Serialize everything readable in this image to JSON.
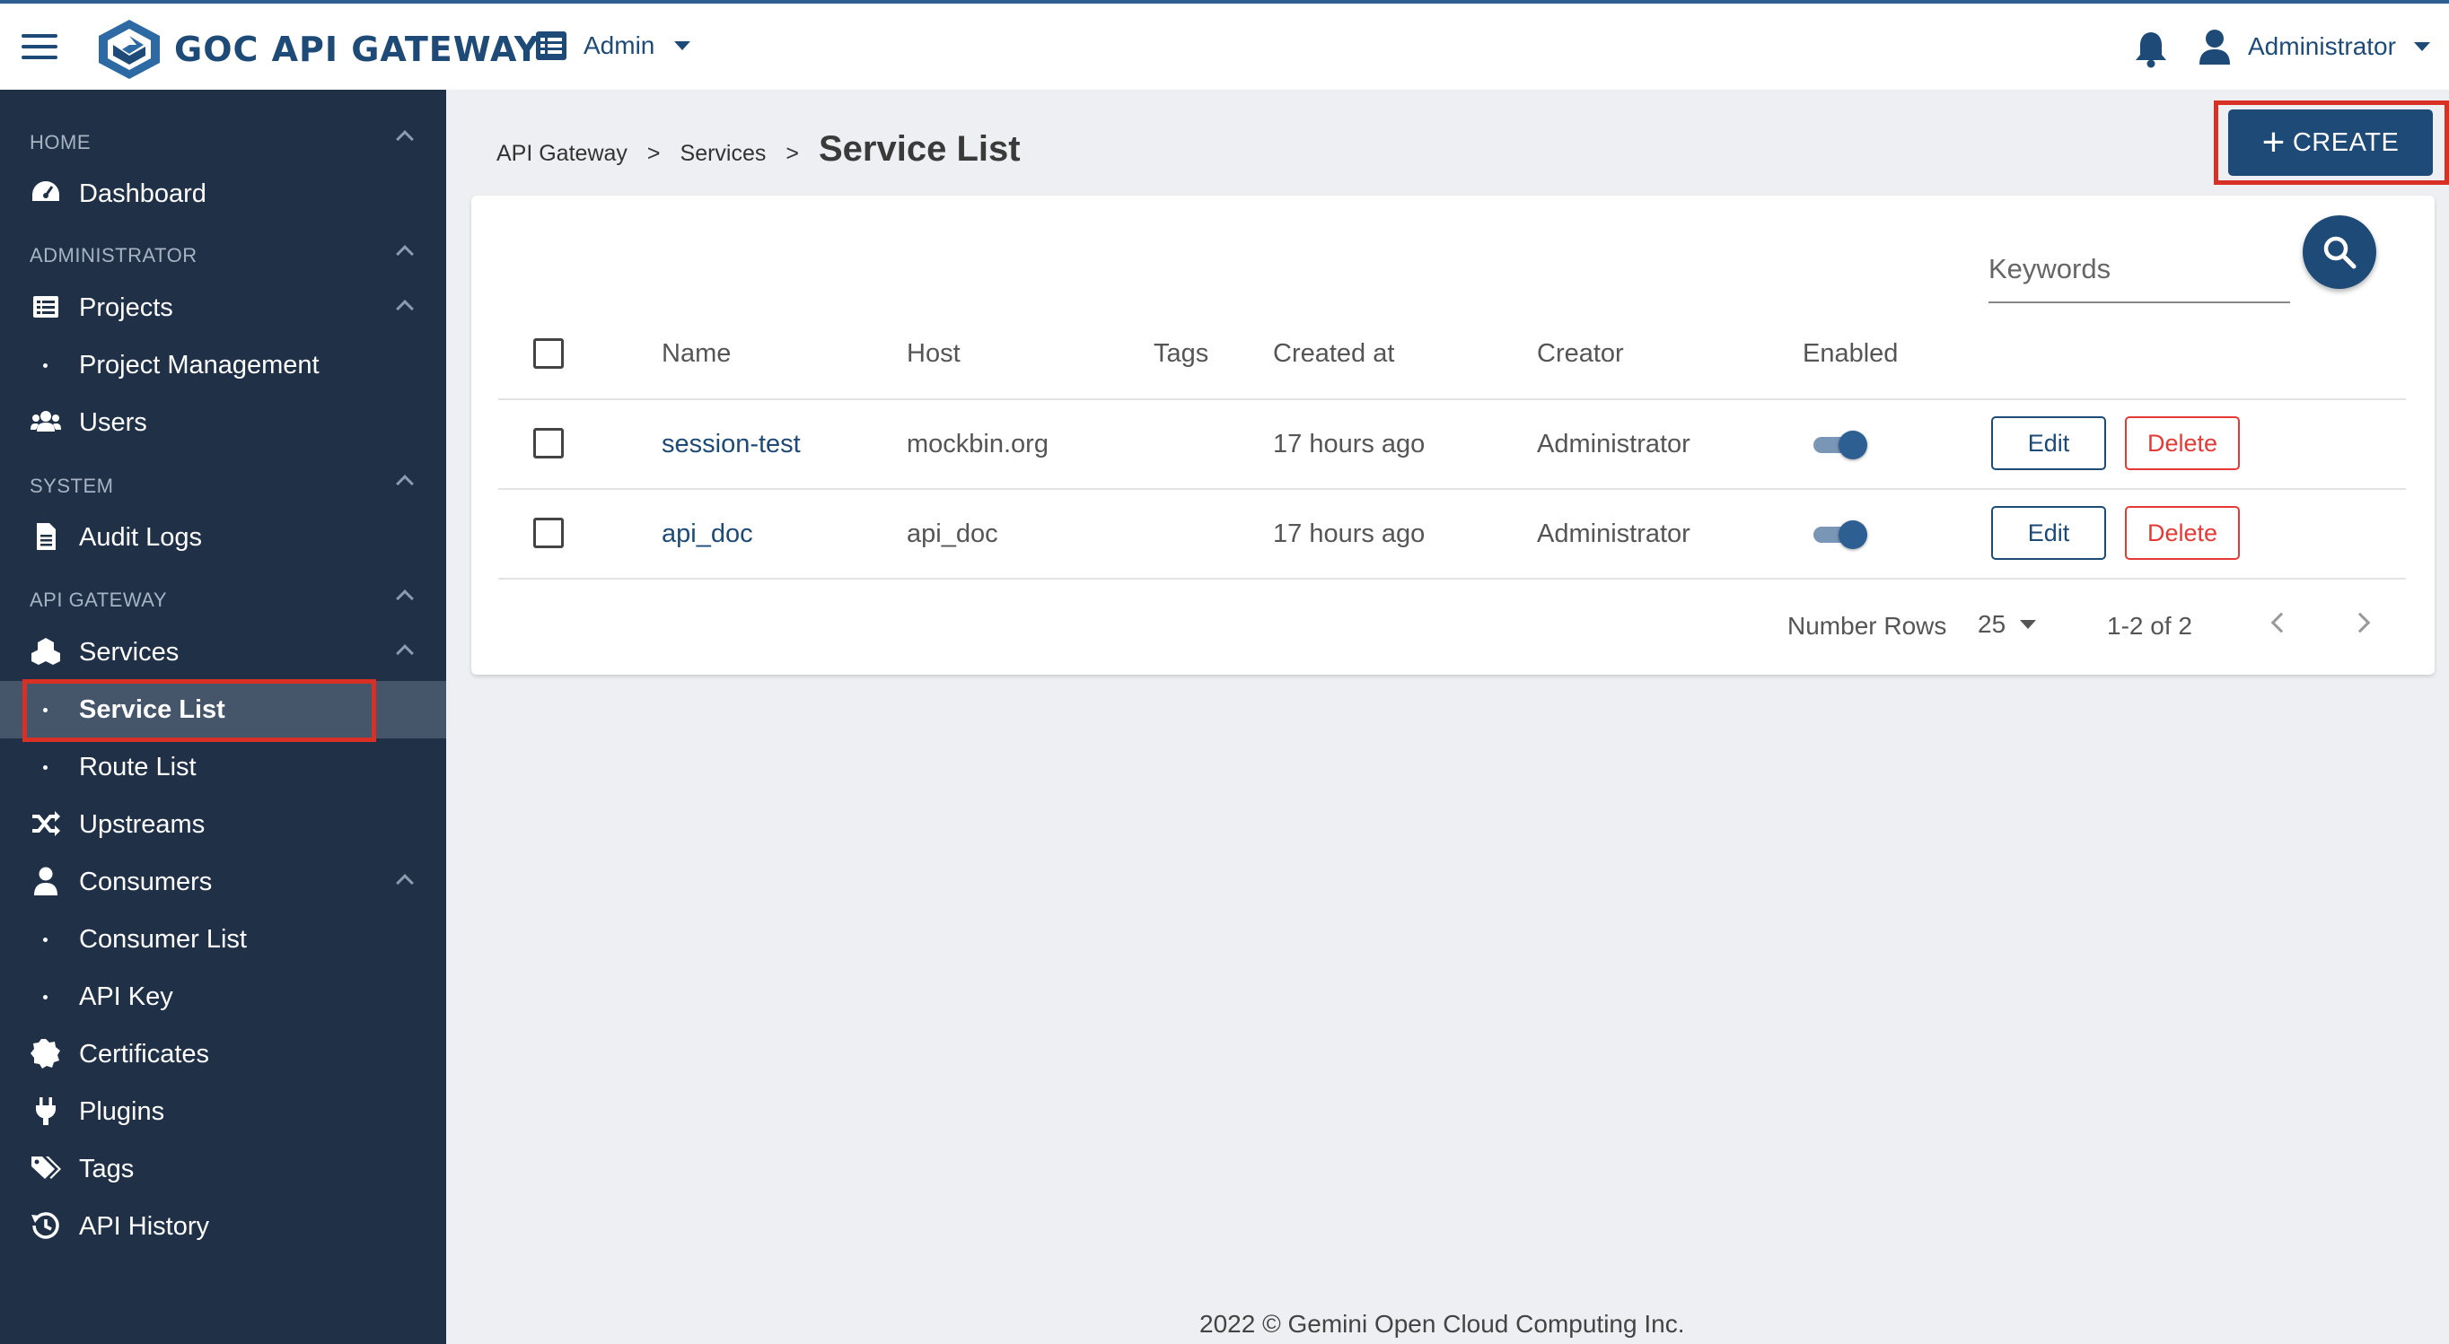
{
  "app": {
    "title": "GOC API GATEWAY",
    "brand_color": "#1e4a78",
    "sidebar_color": "#1f3047"
  },
  "header": {
    "role_menu": "Admin",
    "user_menu": "Administrator"
  },
  "sidebar": {
    "sections": [
      {
        "label": "HOME"
      },
      {
        "label": "ADMINISTRATOR"
      },
      {
        "label": "SYSTEM"
      },
      {
        "label": "API GATEWAY"
      }
    ],
    "items": [
      {
        "label": "Dashboard",
        "icon": "dashboard-icon"
      },
      {
        "label": "Projects",
        "icon": "projects-icon"
      },
      {
        "label": "Project Management"
      },
      {
        "label": "Users",
        "icon": "users-icon"
      },
      {
        "label": "Audit Logs",
        "icon": "file-icon"
      },
      {
        "label": "Services",
        "icon": "services-icon"
      },
      {
        "label": "Service List",
        "active": true
      },
      {
        "label": "Route List"
      },
      {
        "label": "Upstreams",
        "icon": "shuffle-icon"
      },
      {
        "label": "Consumers",
        "icon": "user-icon"
      },
      {
        "label": "Consumer List"
      },
      {
        "label": "API Key"
      },
      {
        "label": "Certificates",
        "icon": "certificate-icon"
      },
      {
        "label": "Plugins",
        "icon": "plug-icon"
      },
      {
        "label": "Tags",
        "icon": "tags-icon"
      },
      {
        "label": "API History",
        "icon": "history-icon"
      }
    ]
  },
  "breadcrumb": {
    "items": [
      "API Gateway",
      "Services"
    ],
    "separator": ">",
    "current": "Service List"
  },
  "toolbar": {
    "create_label": "CREATE",
    "create_icon": "+"
  },
  "search": {
    "placeholder": "Keywords"
  },
  "table": {
    "columns": [
      "Name",
      "Host",
      "Tags",
      "Created at",
      "Creator",
      "Enabled"
    ],
    "rows": [
      {
        "name": "session-test",
        "host": "mockbin.org",
        "tags": "",
        "created": "17 hours ago",
        "creator": "Administrator",
        "enabled": true,
        "edit": "Edit",
        "delete": "Delete"
      },
      {
        "name": "api_doc",
        "host": "api_doc",
        "tags": "",
        "created": "17 hours ago",
        "creator": "Administrator",
        "enabled": true,
        "edit": "Edit",
        "delete": "Delete"
      }
    ]
  },
  "pagination": {
    "rows_label": "Number Rows",
    "rows_value": "25",
    "range": "1-2 of 2"
  },
  "footer": {
    "text": "2022 © Gemini Open Cloud Computing Inc."
  }
}
